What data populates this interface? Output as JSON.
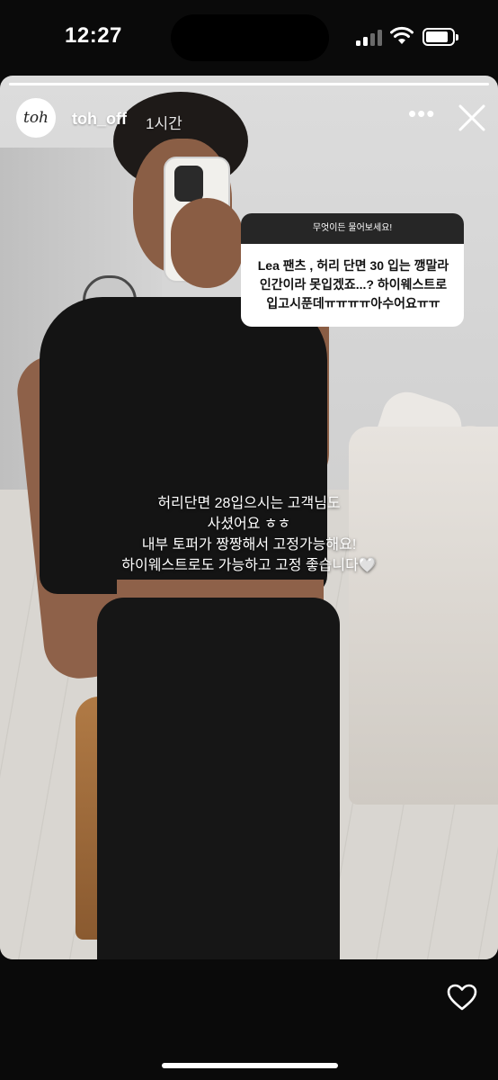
{
  "status_bar": {
    "time": "12:27"
  },
  "story": {
    "username": "toh_off",
    "time_ago": "1시간",
    "avatar_text": "toh",
    "more_label": "•••",
    "progress": 1.0
  },
  "question_sticker": {
    "header": "무엇이든 물어보세요!",
    "lines": [
      "Lea 팬츠 , 허리 단면 30 입는 깽말라",
      "인간이라 못입겠죠...? 하이웨스트로",
      "입고시푼데ㅠㅠㅠㅠ아수어요ㅠㅠ"
    ]
  },
  "caption": {
    "lines": [
      "허리단면 28입으시는 고객님도",
      "사셨어요 ㅎㅎ",
      "내부 토퍼가 짱짱해서 고정가능해요!",
      "하이웨스트로도 가능하고 고정 좋습니다🤍"
    ]
  },
  "icons": {
    "more": "more-icon",
    "close": "close-icon",
    "like": "heart-icon"
  },
  "colors": {
    "background": "#0a0a0a",
    "sticker_header": "#262626"
  }
}
